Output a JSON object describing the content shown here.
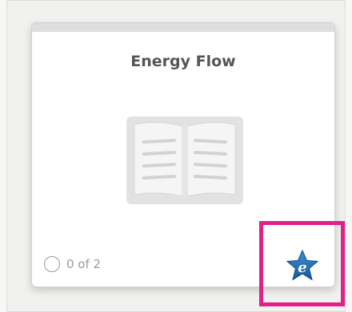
{
  "card": {
    "title": "Energy Flow",
    "progress_text": "0 of 2",
    "content_icon": "open-book-icon",
    "badge_icon": "star-e-icon",
    "colors": {
      "highlight_border": "#e0218a",
      "badge_star": "#1a6fb3"
    }
  }
}
